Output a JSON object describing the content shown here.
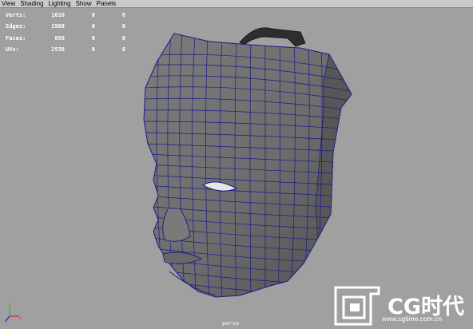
{
  "menu": [
    "View",
    "Shading",
    "Lighting",
    "Show",
    "Panels"
  ],
  "hud": [
    {
      "label": "Verts:",
      "v1": "1010",
      "v2": "0",
      "v3": "0"
    },
    {
      "label": "Edges:",
      "v1": "1908",
      "v2": "0",
      "v3": "0"
    },
    {
      "label": "Faces:",
      "v1": "896",
      "v2": "0",
      "v3": "0"
    },
    {
      "label": "UVs:",
      "v1": "2938",
      "v2": "0",
      "v3": "0"
    }
  ],
  "camera_label": "persp",
  "watermark": {
    "title": "CG时代",
    "url": "www.cgtime.com.cn"
  },
  "colors": {
    "background": "#a0a0a0",
    "wireframe": "#1a1a88",
    "mesh_fill": "#6e6e6e",
    "watermark": "#ffffff",
    "axis_x": "#d83030",
    "axis_y": "#30c030",
    "axis_z": "#3030d0"
  }
}
